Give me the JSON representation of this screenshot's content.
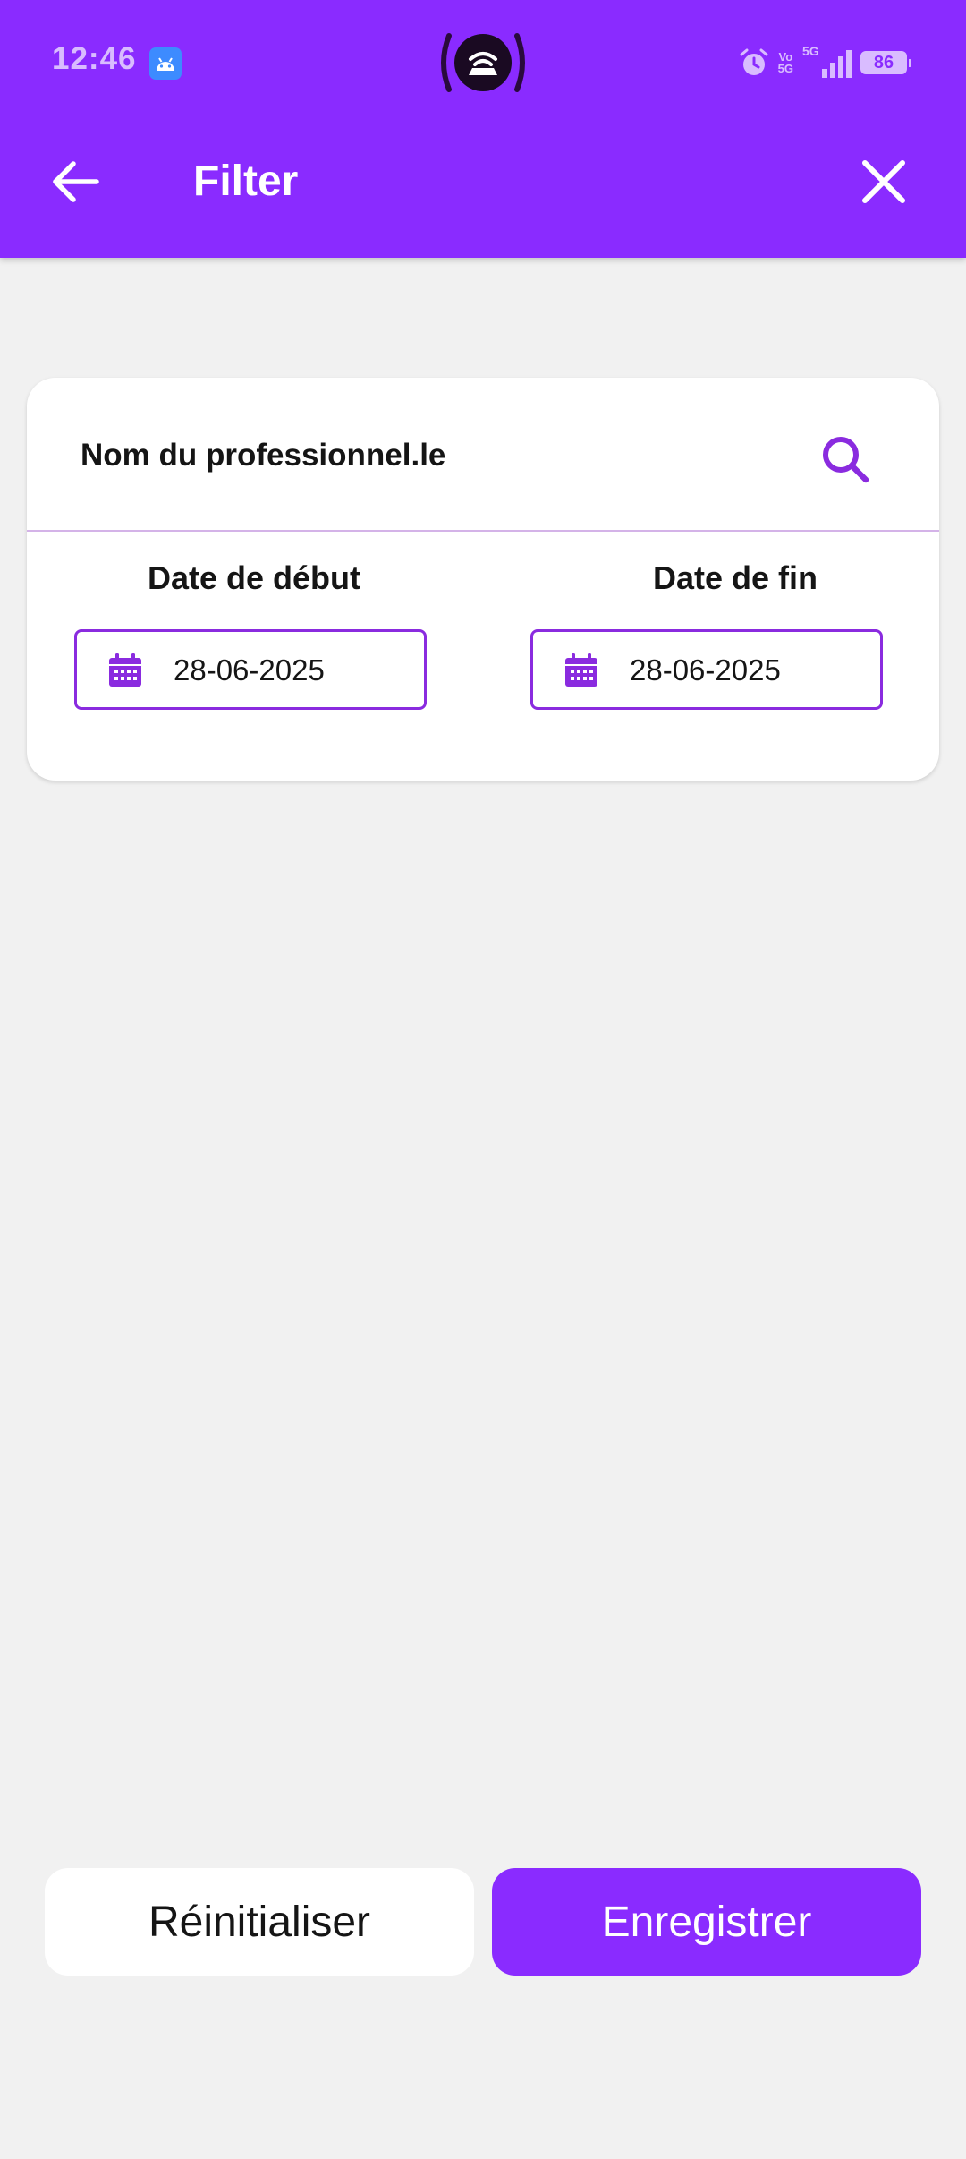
{
  "status_bar": {
    "time": "12:46",
    "battery": "86",
    "icons": [
      "android-notification-icon",
      "hotspot-icon",
      "alarm-icon",
      "volte-icon",
      "5g-signal-icon",
      "battery-icon"
    ],
    "network_label": "5G",
    "volte_label_top": "Vo",
    "volte_label_bottom": "5G"
  },
  "toolbar": {
    "title": "Filter",
    "back_icon": "arrow-left-icon",
    "close_icon": "close-icon"
  },
  "filter_card": {
    "search_label": "Nom du professionnel.le",
    "search_icon": "search-icon",
    "start_date_label": "Date de début",
    "end_date_label": "Date de fin",
    "start_date_value": "28-06-2025",
    "end_date_value": "28-06-2025",
    "calendar_icon": "calendar-icon"
  },
  "actions": {
    "reset_label": "Réinitialiser",
    "save_label": "Enregistrer"
  },
  "colors": {
    "primary": "#8a2bff",
    "background": "#f1f1f1",
    "card": "#ffffff",
    "divider": "#d4b3e8"
  }
}
